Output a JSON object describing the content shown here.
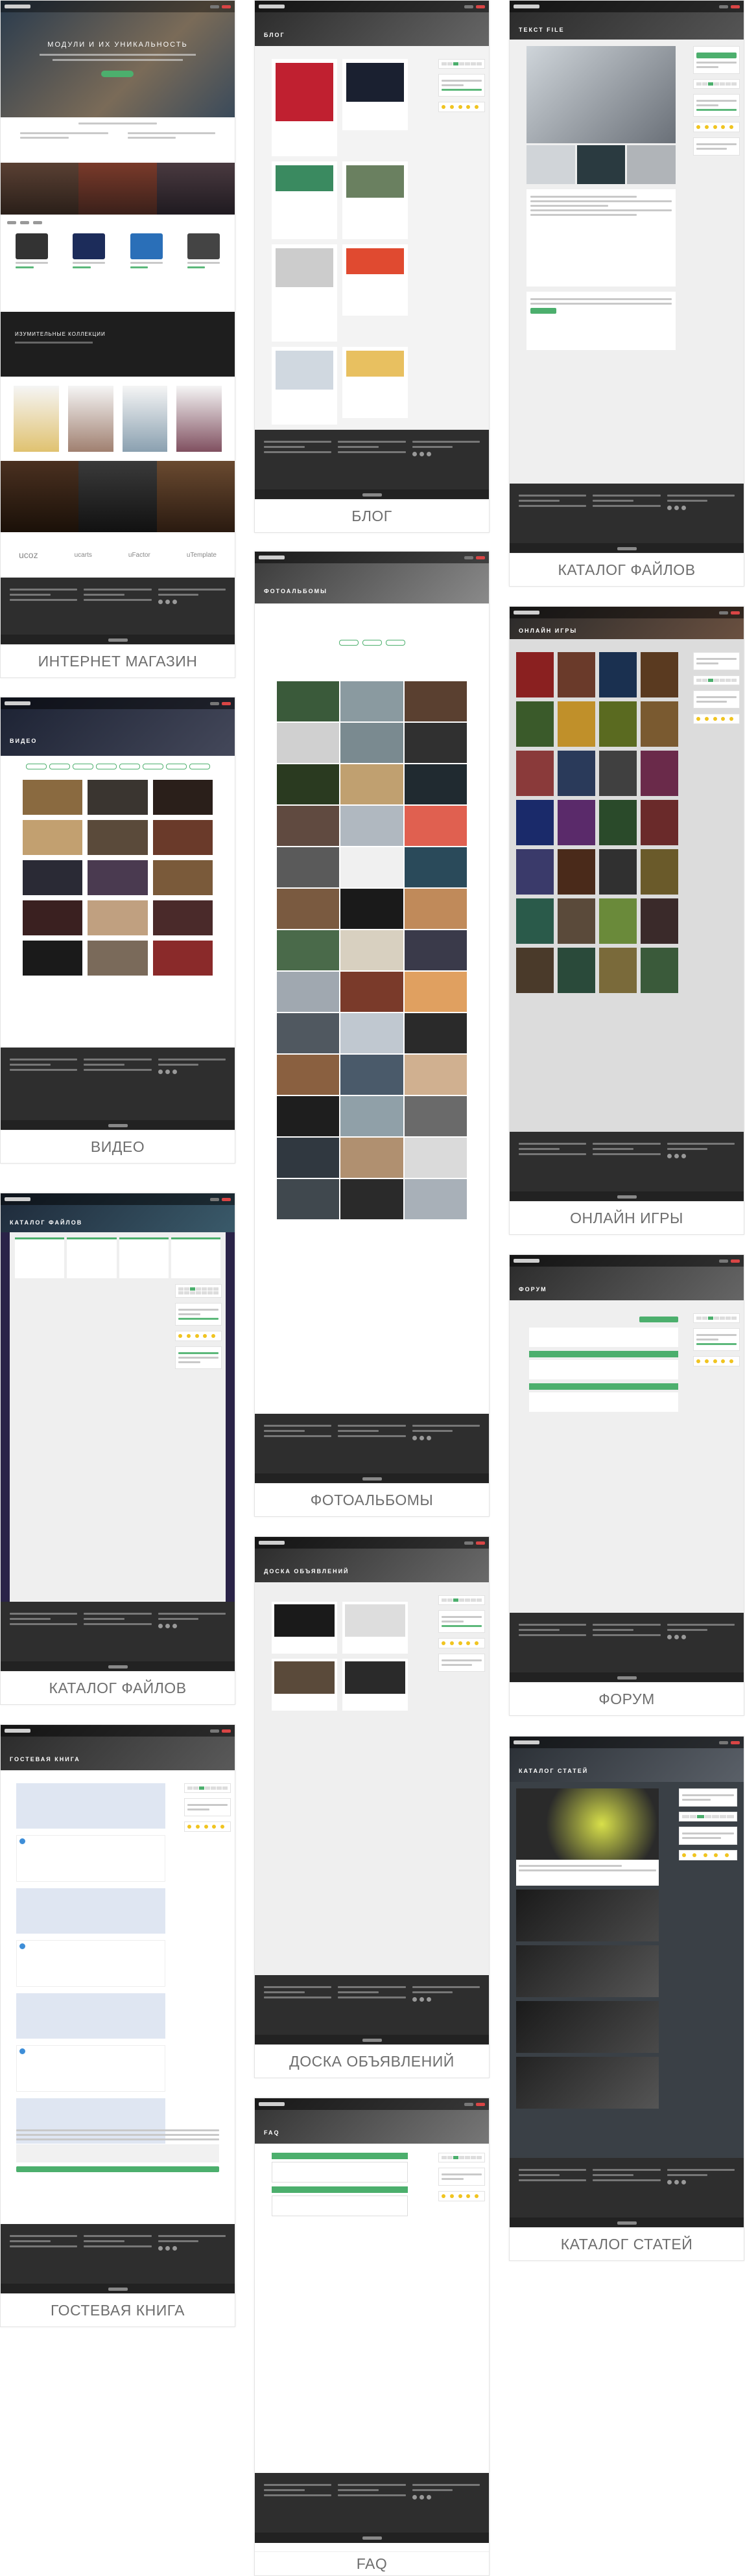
{
  "cards": {
    "shop": {
      "caption": "ИНТЕРНЕТ МАГАЗИН",
      "hero_title": "МОДУЛИ И ИХ УНИКАЛЬНОСТЬ",
      "collections_title": "ИЗУМИТЕЛЬНЫЕ КОЛЛЕКЦИИ",
      "partners": [
        "ucoz",
        "ucarts",
        "uFactor",
        "uTemplate"
      ]
    },
    "blog": {
      "caption": "БЛОГ",
      "hero_title": "БЛОГ"
    },
    "files1": {
      "caption": "КАТАЛОГ ФАЙЛОВ",
      "hero_title": "ТЕКСТ FILE"
    },
    "video": {
      "caption": "ВИДЕО",
      "hero_title": "ВИДЕО"
    },
    "photo": {
      "caption": "ФОТОАЛЬБОМЫ",
      "hero_title": "ФОТОАЛЬБОМЫ"
    },
    "games": {
      "caption": "ОНЛАЙН ИГРЫ",
      "hero_title": "ОНЛАЙН ИГРЫ"
    },
    "files2": {
      "caption": "КАТАЛОГ ФАЙЛОВ",
      "hero_title": "КАТАЛОГ ФАЙЛОВ"
    },
    "board": {
      "caption": "ДОСКА ОБЪЯВЛЕНИЙ",
      "hero_title": "ДОСКА ОБЪЯВЛЕНИЙ"
    },
    "forum": {
      "caption": "ФОРУМ",
      "hero_title": "ФОРУМ"
    },
    "guestbook": {
      "caption": "ГОСТЕВАЯ КНИГА",
      "hero_title": "ГОСТЕВАЯ КНИГА"
    },
    "articles": {
      "caption": "КАТАЛОГ СТАТЕЙ",
      "hero_title": "КАТАЛОГ СТАТЕЙ"
    },
    "faq": {
      "caption": "FAQ",
      "hero_title": "FAQ"
    }
  },
  "colors": {
    "accent": "#4caf6d",
    "dark": "#2e2e2e",
    "caption": "#6e6e6e"
  }
}
